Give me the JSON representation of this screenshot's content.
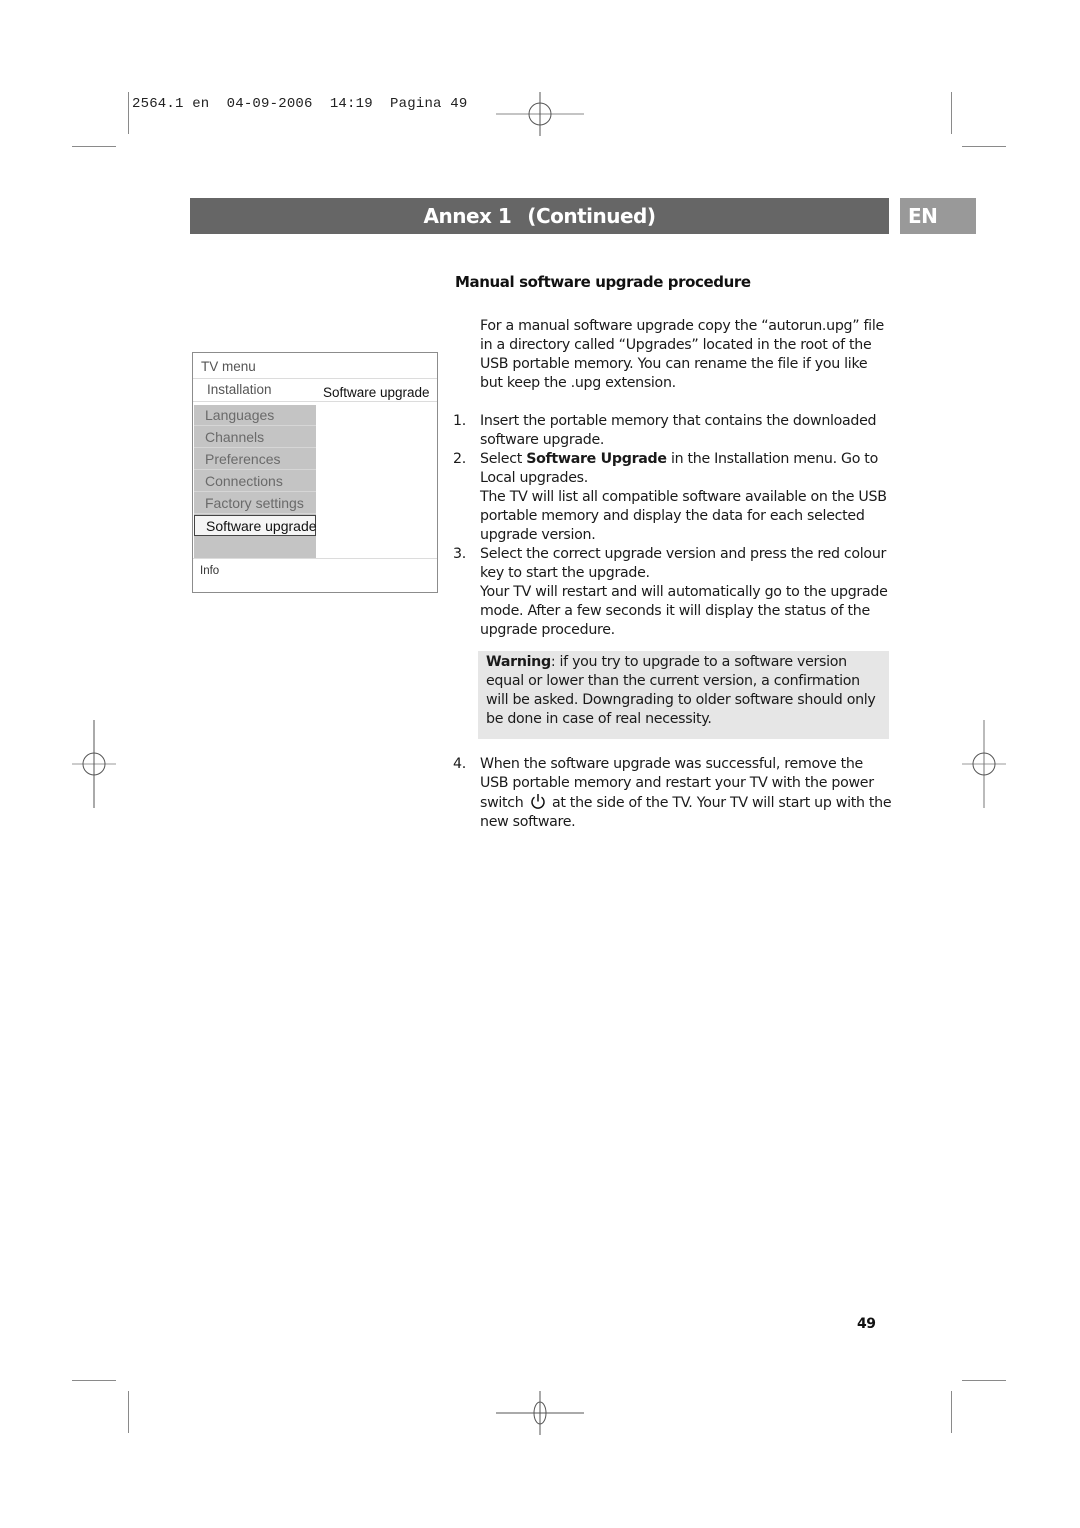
{
  "slug": {
    "text": "2564.1 en  04-09-2006  14:19  Pagina 49"
  },
  "banner": {
    "title": "Annex 1",
    "subtitle": "(Continued)",
    "language_tab": "EN",
    "colors": {
      "banner": "#666666",
      "language_tab": "#999999"
    }
  },
  "tv_menu": {
    "title": "TV menu",
    "breadcrumb": "Installation",
    "panel_title": "Software upgrade",
    "items": [
      {
        "label": "Languages",
        "selected": false
      },
      {
        "label": "Channels",
        "selected": false
      },
      {
        "label": "Preferences",
        "selected": false
      },
      {
        "label": "Connections",
        "selected": false
      },
      {
        "label": "Factory settings",
        "selected": false
      },
      {
        "label": "Software upgrade",
        "selected": true
      }
    ],
    "info_label": "Info"
  },
  "section": {
    "title": "Manual software upgrade procedure",
    "intro": "For a manual software upgrade copy the “autorun.upg” file in a directory called “Upgrades” located in the root of the USB portable memory. You can rename the file if you like but keep the .upg extension.",
    "steps": [
      {
        "num": "1.",
        "text": "Insert the portable memory that contains the downloaded software upgrade."
      },
      {
        "num": "2.",
        "pre": "Select ",
        "bold": "Software Upgrade",
        "post": " in the Installation menu. Go to Local upgrades.",
        "extra": "The TV will list all compatible software available on the USB portable memory and display the data for each selected upgrade version."
      },
      {
        "num": "3.",
        "text": "Select the correct upgrade version and press the red colour key to start the upgrade.",
        "extra": "Your TV will restart and will automatically go to the upgrade mode. After a few seconds it will display the status of the upgrade procedure."
      },
      {
        "num": "4.",
        "pre": "When the software upgrade was successful, remove the USB portable memory and restart your TV with the power switch",
        "icon": "power-icon",
        "post": "at the side of the TV. Your TV will start up with the new software."
      }
    ],
    "warning": {
      "label": "Warning",
      "text": ": if you try to upgrade to a software version equal or lower than the current version, a confirmation will be asked. Downgrading to older software should only be done in case of real necessity."
    }
  },
  "footer": {
    "page_number": "49"
  }
}
